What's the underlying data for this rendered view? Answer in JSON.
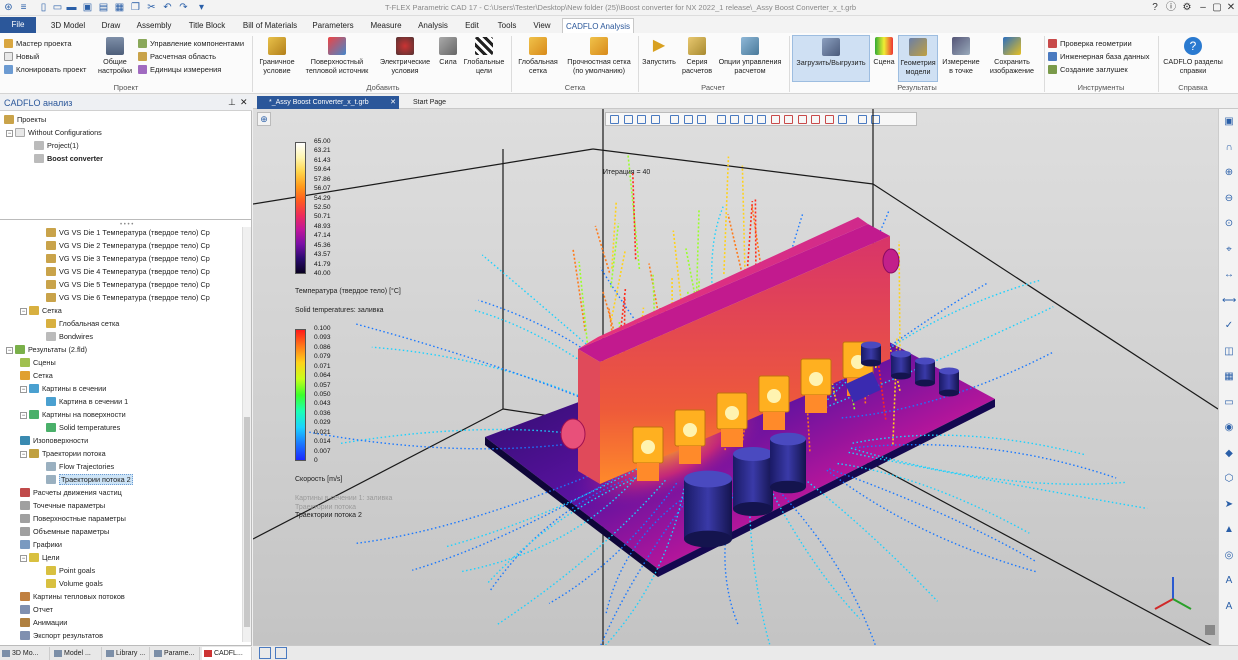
{
  "window": {
    "title": "T-FLEX Parametric CAD 17 - C:\\Users\\Tester\\Desktop\\New folder (25)\\Boost converter for NX 2022_1 release\\_Assy Boost Converter_x_t.grb"
  },
  "ribbon_tabs": [
    "File",
    "3D Model",
    "Draw",
    "Assembly",
    "Title Block",
    "Bill of Materials",
    "Parameters",
    "Measure",
    "Analysis",
    "Edit",
    "Tools",
    "View",
    "CADFLO Analysis"
  ],
  "ribbon": {
    "project": {
      "small": [
        "Мастер проекта",
        "Новый",
        "Клонировать проект"
      ],
      "big": "Общие настройки",
      "small2": [
        "Управление компонентами",
        "Расчетная область",
        "Единицы измерения"
      ],
      "label": "Проект"
    },
    "add": {
      "big": [
        "Граничное условие",
        "Поверхностный тепловой источник",
        "Электрические условия",
        "Сила",
        "Глобальные цели"
      ],
      "label": "Добавить"
    },
    "mesh": {
      "big": [
        "Глобальная сетка",
        "Прочностная сетка (по умолчанию)"
      ],
      "label": "Сетка"
    },
    "calc": {
      "big": [
        "Запустить",
        "Серия расчетов",
        "Опции управления расчетом"
      ],
      "label": "Расчет"
    },
    "results": {
      "big": [
        "Загрузить/Выгрузить",
        "Сцена",
        "Геометрия модели",
        "Измерение в точке",
        "Сохранить изображение"
      ],
      "label": "Результаты"
    },
    "tools": {
      "small": [
        "Проверка геометрии",
        "Инженерная база данных",
        "Создание заглушек"
      ],
      "label": "Инструменты"
    },
    "help": {
      "big": "CADFLO разделы справки",
      "label": "Справка"
    }
  },
  "panel": {
    "title": "CADFLO анализ",
    "top_tree": [
      "Проекты",
      "Without Configurations",
      "Project(1)",
      "Boost converter"
    ],
    "items": [
      "VG VS Die 1 Температура (твердое тело) Ср",
      "VG VS Die 2 Температура (твердое тело) Ср",
      "VG VS Die 3 Температура (твердое тело) Ср",
      "VG VS Die 4 Температура (твердое тело) Ср",
      "VG VS Die 5 Температура (твердое тело) Ср",
      "VG VS Die 6 Температура (твердое тело) Ср",
      "Сетка",
      "Глобальная сетка",
      "Bondwires",
      "Результаты (2.fld)",
      "Сцены",
      "Сетка",
      "Картины в сечении",
      "Картина в сечении 1",
      "Картины на поверхности",
      "Solid temperatures",
      "Изоповерхности",
      "Траектории потока",
      "Flow Trajectories",
      "Траектории потока 2",
      "Расчеты движения частиц",
      "Точечные параметры",
      "Поверхностные параметры",
      "Объемные параметры",
      "Графики",
      "Цели",
      "Point goals",
      "Volume goals",
      "Картины тепловых потоков",
      "Отчет",
      "Анимации",
      "Экспорт результатов"
    ]
  },
  "bottom_tabs": [
    "3D Mo...",
    "Model ...",
    "Library ...",
    "Parame...",
    "CADFL..."
  ],
  "doc_tabs": [
    "*_Assy Boost Converter_x_t.grb",
    "Start Page"
  ],
  "viewport": {
    "iteration": "Итерация = 40",
    "temp_legend": {
      "ticks": [
        "65.00",
        "63.21",
        "61.43",
        "59.64",
        "57.86",
        "56.07",
        "54.29",
        "52.50",
        "50.71",
        "48.93",
        "47.14",
        "45.36",
        "43.57",
        "41.79",
        "40.00"
      ],
      "title": "Температура (твердое тело) [°C]",
      "colors": [
        "#ffffff",
        "#fff6b0",
        "#ffd54a",
        "#ff9b1a",
        "#ff5a1f",
        "#ee2b5a",
        "#c0169a",
        "#7a0fa6",
        "#2a0a6e",
        "#0a0222"
      ]
    },
    "scene_label": "Solid temperatures: заливка",
    "vel_legend": {
      "ticks": [
        "0.100",
        "0.093",
        "0.086",
        "0.079",
        "0.071",
        "0.064",
        "0.057",
        "0.050",
        "0.043",
        "0.036",
        "0.029",
        "0.021",
        "0.014",
        "0.007",
        "0"
      ],
      "title": "Скорость [m/s]",
      "colors": [
        "#ff1a1a",
        "#ff7a1a",
        "#ffd21a",
        "#c8ff1a",
        "#3cff2a",
        "#1affb4",
        "#1ad2ff",
        "#1a78ff",
        "#1a28ff"
      ]
    },
    "faded_label": "Картины в сечении 1: заливка",
    "faded_label2": "Траектории потока",
    "traj_label": "Траектории потока 2"
  }
}
